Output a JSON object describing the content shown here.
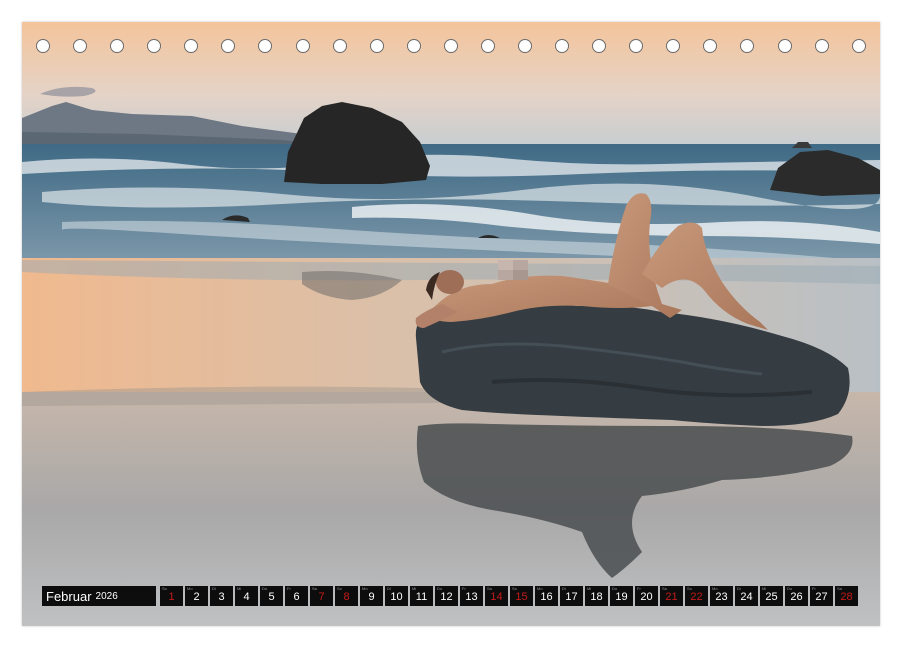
{
  "calendar": {
    "month": "Februar",
    "year": "2026",
    "days": [
      {
        "wd": "So",
        "num": "1",
        "weekend": true
      },
      {
        "wd": "Mo",
        "num": "2",
        "weekend": false
      },
      {
        "wd": "Di",
        "num": "3",
        "weekend": false
      },
      {
        "wd": "Mi",
        "num": "4",
        "weekend": false
      },
      {
        "wd": "Do",
        "num": "5",
        "weekend": false
      },
      {
        "wd": "Fr",
        "num": "6",
        "weekend": false
      },
      {
        "wd": "Sa",
        "num": "7",
        "weekend": true
      },
      {
        "wd": "So",
        "num": "8",
        "weekend": true
      },
      {
        "wd": "Mo",
        "num": "9",
        "weekend": false
      },
      {
        "wd": "Di",
        "num": "10",
        "weekend": false
      },
      {
        "wd": "Mi",
        "num": "11",
        "weekend": false
      },
      {
        "wd": "Do",
        "num": "12",
        "weekend": false
      },
      {
        "wd": "Fr",
        "num": "13",
        "weekend": false
      },
      {
        "wd": "Sa",
        "num": "14",
        "weekend": true
      },
      {
        "wd": "So",
        "num": "15",
        "weekend": true
      },
      {
        "wd": "Mo",
        "num": "16",
        "weekend": false
      },
      {
        "wd": "Di",
        "num": "17",
        "weekend": false
      },
      {
        "wd": "Mi",
        "num": "18",
        "weekend": false
      },
      {
        "wd": "Do",
        "num": "19",
        "weekend": false
      },
      {
        "wd": "Fr",
        "num": "20",
        "weekend": false
      },
      {
        "wd": "Sa",
        "num": "21",
        "weekend": true
      },
      {
        "wd": "So",
        "num": "22",
        "weekend": true
      },
      {
        "wd": "Mo",
        "num": "23",
        "weekend": false
      },
      {
        "wd": "Di",
        "num": "24",
        "weekend": false
      },
      {
        "wd": "Mi",
        "num": "25",
        "weekend": false
      },
      {
        "wd": "Do",
        "num": "26",
        "weekend": false
      },
      {
        "wd": "Fr",
        "num": "27",
        "weekend": false
      },
      {
        "wd": "Sa",
        "num": "28",
        "weekend": true
      }
    ]
  },
  "colors": {
    "weekend_number": "#c41a1a",
    "strip_background": "#0d0d0d",
    "sky_top": "#f6caa0",
    "sea": "#4a6f88",
    "sand_glow": "#f2b889"
  },
  "photo": {
    "scene": "beach-at-dusk",
    "censor_mark": "gray-blur-square"
  }
}
